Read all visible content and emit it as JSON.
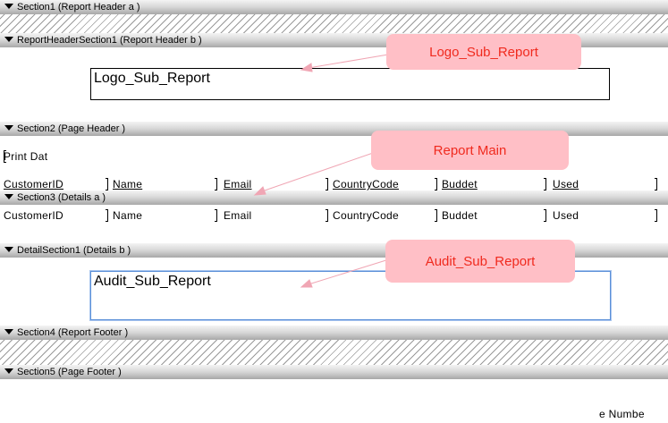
{
  "sections": [
    {
      "label": "Section1 (Report Header a )"
    },
    {
      "label": "ReportHeaderSection1 (Report Header b )"
    },
    {
      "label": "Section2 (Page Header  )"
    },
    {
      "label": "Section3 (Details a )"
    },
    {
      "label": "DetailSection1 (Details b )"
    },
    {
      "label": "Section4 (Report Footer  )"
    },
    {
      "label": "Section5 (Page Footer  )"
    }
  ],
  "logo_subreport": "Logo_Sub_Report",
  "audit_subreport": "Audit_Sub_Report",
  "print_date": "Print Dat",
  "page_number": "e Numbe",
  "header_fields": [
    "CustomerID",
    "Name",
    "Email",
    "CountryCode",
    "Buddet",
    "Used"
  ],
  "detail_fields": [
    "CustomerID",
    "Name",
    "Email",
    "CountryCode",
    "Buddet",
    "Used"
  ],
  "callouts": {
    "logo": "Logo_Sub_Report",
    "main": "Report Main",
    "audit": "Audit_Sub_Report"
  }
}
